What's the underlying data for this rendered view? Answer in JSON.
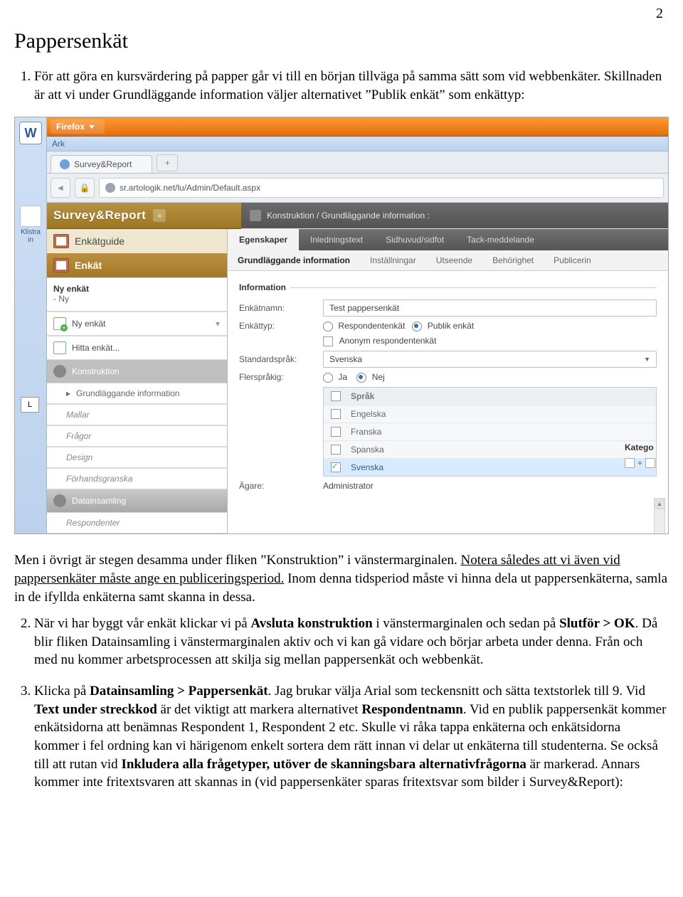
{
  "page_number": "2",
  "doc": {
    "title": "Pappersenkät",
    "item1_a": "För att göra en kursvärdering på papper går vi till en början tillväga på samma sätt som vid webbenkäter. Skillnaden är att vi under Grundläggande information väljer alternativet ”Publik enkät” som enkättyp:",
    "after_img_a": "Men i övrigt är stegen desamma under fliken ”Konstruktion” i vänstermarginalen. ",
    "after_img_b": "Notera således att vi även vid pappersenkäter måste ange en publiceringsperiod.",
    "after_img_c": " Inom denna tidsperiod måste vi hinna dela ut pappersenkäterna, samla in de ifyllda enkäterna samt skanna in dessa.",
    "item2_a": "När vi har byggt vår enkät klickar vi på ",
    "item2_b": "Avsluta konstruktion",
    "item2_c": " i vänstermarginalen och sedan på ",
    "item2_d": "Slutför > OK",
    "item2_e": ". Då blir fliken Datainsamling i vänstermarginalen aktiv och vi kan gå vidare och börjar arbeta under denna. Från och med nu kommer arbetsprocessen att skilja sig mellan pappersenkät och webbenkät.",
    "item3_a": "Klicka på ",
    "item3_b": "Datainsamling > Pappersenkät",
    "item3_c": ". Jag brukar välja Arial som teckensnitt och sätta textstorlek till 9. Vid ",
    "item3_d": "Text under streckkod",
    "item3_e": " är det viktigt att markera alternativet ",
    "item3_f": "Respondentnamn",
    "item3_g": ". Vid en publik pappersenkät kommer enkätsidorna att benämnas Respondent 1, Respondent 2 etc. Skulle vi råka tappa enkäterna och enkätsidorna kommer i fel ordning kan vi härigenom enkelt sortera dem rätt innan vi delar ut enkäterna till studenterna. Se också till att rutan vid ",
    "item3_h": "Inkludera alla frågetyper, utöver de skanningsbara alternativfrågorna",
    "item3_i": " är markerad. Annars kommer inte fritextsvaren att skannas in (vid pappersenkäter sparas fritextsvar som bilder i Survey&Report):"
  },
  "shot": {
    "word_w": "W",
    "ark": "Ark",
    "klistra": "Klistra in",
    "L": "L",
    "firefox": "Firefox",
    "tabtitle": "Survey&Report",
    "plus": "+",
    "nav_back": "◄",
    "nav_lock": "🔒",
    "url": "sr.artologik.net/lu/Admin/Default.aspx",
    "app_logo": "Survey&Report",
    "chev": "«",
    "crumb_icon": "▦",
    "crumb": "Konstruktion / Grundläggande information :",
    "left": {
      "guide": "Enkätguide",
      "enkat": "Enkät",
      "ny_head": "Ny enkät",
      "ny_sub": "- Ny",
      "ny_item": "Ny enkät",
      "hitta": "Hitta enkät...",
      "konstruktion": "Konstruktion",
      "grund": "Grundläggande information",
      "mallar": "Mallar",
      "fragor": "Frågor",
      "design": "Design",
      "forhand": "Förhandsgranska",
      "datainsamling": "Datainsamling",
      "respondenter": "Respondenter",
      "caret": "▾",
      "arrow": "▸"
    },
    "tabs": {
      "egenskaper": "Egenskaper",
      "inledning": "Inledningstext",
      "sidhuvud": "Sidhuvud/sidfot",
      "tack": "Tack-meddelande"
    },
    "subtabs": {
      "grund": "Grundläggande information",
      "install": "Inställningar",
      "utseende": "Utseende",
      "behorighet": "Behörighet",
      "publ": "Publicerin"
    },
    "form": {
      "section_info": "Information",
      "section_kat": "Katego",
      "enkatnamn_l": "Enkätnamn:",
      "enkatnamn_v": "Test pappersenkät",
      "enkattyp_l": "Enkättyp:",
      "r_resp": "Respondentenkät",
      "r_publ": "Publik enkät",
      "c_anon": "Anonym respondentenkät",
      "sprak_l": "Standardspråk:",
      "sprak_v": "Svenska",
      "fler_l": "Flerspråkig:",
      "r_ja": "Ja",
      "r_nej": "Nej",
      "langhead": "Språk",
      "lang_en": "Engelska",
      "lang_fr": "Franska",
      "lang_es": "Spanska",
      "lang_sv": "Svenska",
      "agare_l": "Ägare:",
      "agare_v": "Administrator",
      "dd": "▼",
      "exp": "+",
      "scroll_up": "▲",
      "scroll_dn": "▼"
    }
  }
}
